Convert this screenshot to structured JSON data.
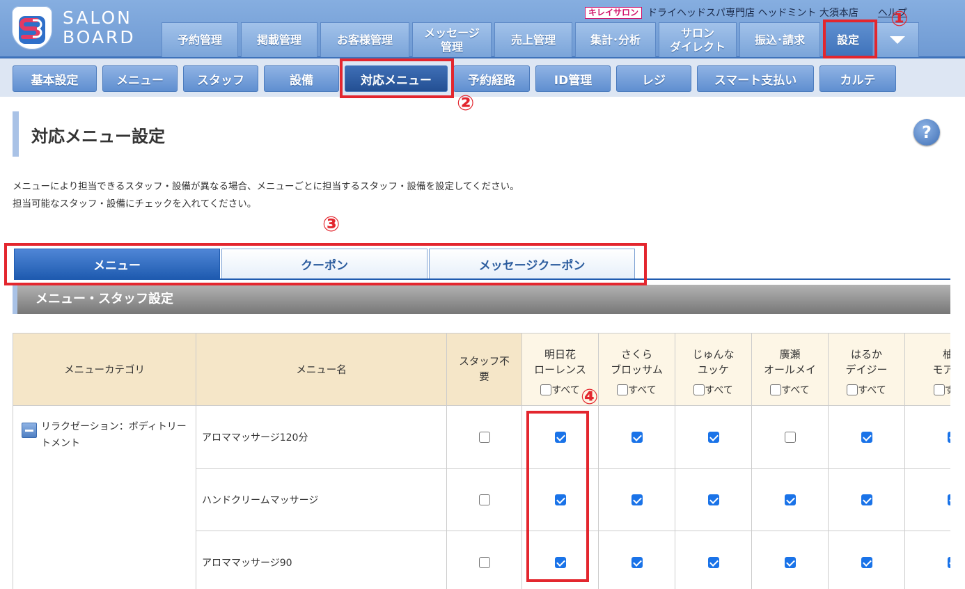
{
  "brand": {
    "logo_line1": "SALON",
    "logo_line2": "BOARD"
  },
  "account": {
    "badge": "キレイサロン",
    "shop_name": "ドライヘッドスパ専門店 ヘッドミント 大須本店",
    "help": "ヘルプ"
  },
  "main_nav": [
    {
      "label": "予約管理"
    },
    {
      "label": "掲載管理"
    },
    {
      "label": "お客様管理"
    },
    {
      "label": "メッセージ\n管理"
    },
    {
      "label": "売上管理"
    },
    {
      "label": "集計･分析"
    },
    {
      "label": "サロン\nダイレクト"
    },
    {
      "label": "振込･請求"
    },
    {
      "label": "設定"
    }
  ],
  "sub_nav": [
    {
      "label": "基本設定"
    },
    {
      "label": "メニュー"
    },
    {
      "label": "スタッフ"
    },
    {
      "label": "設備"
    },
    {
      "label": "対応メニュー"
    },
    {
      "label": "予約経路"
    },
    {
      "label": "ID管理"
    },
    {
      "label": "レジ"
    },
    {
      "label": "スマート支払い"
    },
    {
      "label": "カルテ"
    }
  ],
  "page": {
    "title": "対応メニュー設定",
    "help_icon": "?",
    "desc1": "メニューにより担当できるスタッフ・設備が異なる場合、メニューごとに担当するスタッフ・設備を設定してください。",
    "desc2": "担当可能なスタッフ・設備にチェックを入れてください。"
  },
  "tabs": [
    {
      "label": "メニュー"
    },
    {
      "label": "クーポン"
    },
    {
      "label": "メッセージクーポン"
    }
  ],
  "section_title": "メニュー・スタッフ設定",
  "table": {
    "headers": {
      "category": "メニューカテゴリ",
      "menu_name": "メニュー名",
      "no_staff": "スタッフ不要",
      "all": "すべて"
    },
    "staff": [
      {
        "line1": "明日花",
        "line2": "ローレンス"
      },
      {
        "line1": "さくら",
        "line2": "ブロッサム"
      },
      {
        "line1": "じゅんな",
        "line2": "ユッケ"
      },
      {
        "line1": "廣瀬",
        "line2": "オールメイ"
      },
      {
        "line1": "はるか",
        "line2": "デイジー"
      },
      {
        "line1": "柚希",
        "line2": "モアクレ"
      }
    ],
    "category": "リラクゼーション：ボディトリートメント",
    "rows": [
      {
        "menu": "アロママッサージ120分",
        "no_staff": false,
        "checks": [
          true,
          true,
          true,
          false,
          true,
          true
        ]
      },
      {
        "menu": "ハンドクリームマッサージ",
        "no_staff": false,
        "checks": [
          true,
          true,
          true,
          true,
          true,
          true
        ]
      },
      {
        "menu": "アロママッサージ90",
        "no_staff": false,
        "checks": [
          true,
          true,
          true,
          true,
          true,
          true
        ]
      }
    ]
  },
  "annotations": {
    "n1": "①",
    "n2": "②",
    "n3": "③",
    "n4": "④"
  },
  "colors": {
    "annotation_red": "#e3262e",
    "primary_blue": "#1f5bb0",
    "header_bg": "#7aa4d9",
    "table_header": "#f5e6c8"
  }
}
